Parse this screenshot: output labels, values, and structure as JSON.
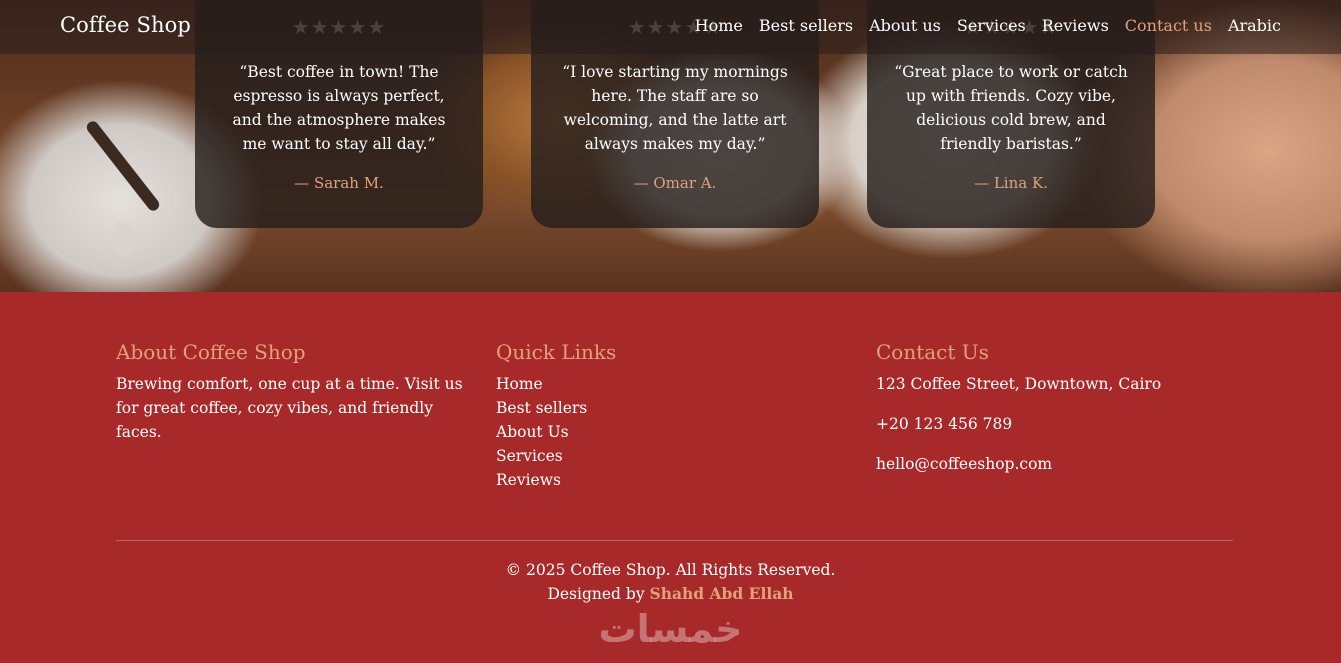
{
  "navbar": {
    "brand": "Coffee Shop",
    "links": [
      "Home",
      "Best sellers",
      "About us",
      "Services",
      "Reviews",
      "Contact us",
      "Arabic"
    ],
    "active": "Contact us"
  },
  "testimonials": [
    {
      "stars": "★★★★★",
      "quote": "“Best coffee in town! The espresso is always perfect, and the atmosphere makes me want to stay all day.”",
      "author": "— Sarah M."
    },
    {
      "stars": "★★★★★",
      "quote": "“I love starting my mornings here. The staff are so welcoming, and the latte art always makes my day.”",
      "author": "— Omar A."
    },
    {
      "stars": "★★★★★",
      "quote": "“Great place to work or catch up with friends. Cozy vibe, delicious cold brew, and friendly baristas.”",
      "author": "— Lina K."
    }
  ],
  "footer": {
    "about": {
      "title": "About Coffee Shop",
      "text": "Brewing comfort, one cup at a time. Visit us for great coffee, cozy vibes, and friendly faces."
    },
    "quick_links": {
      "title": "Quick Links",
      "items": [
        "Home",
        "Best sellers",
        "About Us",
        "Services",
        "Reviews"
      ]
    },
    "contact": {
      "title": "Contact Us",
      "address": "123 Coffee Street, Downtown, Cairo",
      "phone": "+20 123 456 789",
      "email": "hello@coffeeshop.com"
    },
    "copyright": "© 2025 Coffee Shop. All Rights Reserved.",
    "designed_by_label": "Designed by",
    "designer": "Shahd Abd Ellah"
  },
  "watermark": "خمسات",
  "colors": {
    "footer_bg": "#a8292a",
    "accent": "#e0a27a",
    "card_bg": "#261e1c"
  }
}
